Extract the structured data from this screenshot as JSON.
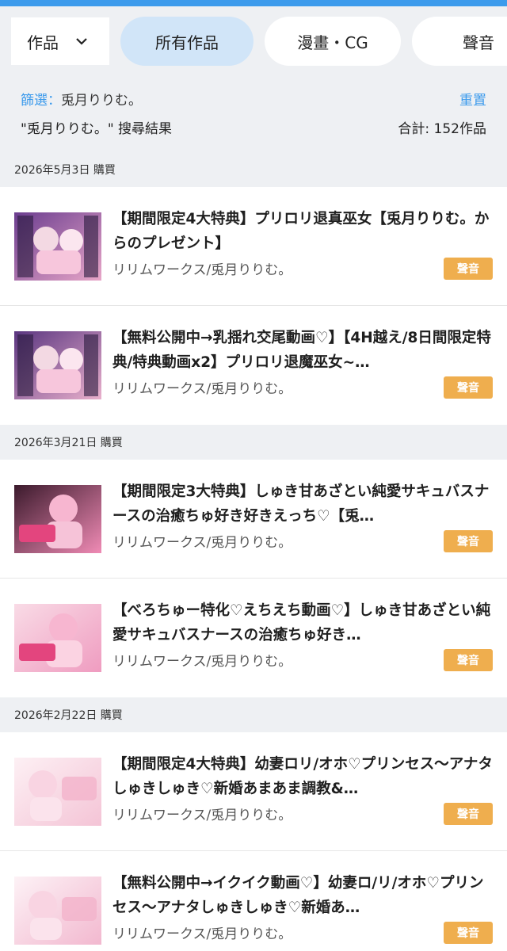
{
  "filters": {
    "type_select": "作品",
    "chips": [
      "所有作品",
      "漫畫・CG",
      "聲音"
    ]
  },
  "filter_info": {
    "label": "篩選：",
    "value": "兎月りりむ。",
    "reset": "重置",
    "query": "\"兎月りりむ。\" 搜尋結果",
    "total": "合計: 152作品"
  },
  "groups": [
    {
      "date": "2026年5月3日 購買",
      "items": [
        {
          "title": "【期間限定4大特典】プリロリ退真巫女【兎月りりむ。からのプレゼント】",
          "maker": "リリムワークス/兎月りりむ。",
          "badge": "聲音"
        },
        {
          "title": "【無料公開中→乳揺れ交尾動画♡】【4H越え/8日間限定特典/特典動画x2】プリロリ退魔巫女~…",
          "maker": "リリムワークス/兎月りりむ。",
          "badge": "聲音"
        }
      ]
    },
    {
      "date": "2026年3月21日 購買",
      "items": [
        {
          "title": "【期間限定3大特典】しゅき甘あざとい純愛サキュバスナースの治癒ちゅ好き好きえっち♡【兎…",
          "maker": "リリムワークス/兎月りりむ。",
          "badge": "聲音"
        },
        {
          "title": "【べろちゅー特化♡えちえち動画♡】しゅき甘あざとい純愛サキュバスナースの治癒ちゅ好き…",
          "maker": "リリムワークス/兎月りりむ。",
          "badge": "聲音"
        }
      ]
    },
    {
      "date": "2026年2月22日 購買",
      "items": [
        {
          "title": "【期間限定4大特典】幼妻ロリ/オホ♡プリンセス～アナタしゅきしゅき♡新婚あまあま調教&…",
          "maker": "リリムワークス/兎月りりむ。",
          "badge": "聲音"
        },
        {
          "title": "【無料公開中→イクイク動画♡】幼妻ロ/リ/オホ♡プリンセス～アナタしゅきしゅき♡新婚あ…",
          "maker": "リリムワークス/兎月りりむ。",
          "badge": "聲音"
        }
      ]
    }
  ],
  "colors": {
    "accent": "#3d9bec",
    "active_chip": "#d1e5f8",
    "badge": "#efae4e",
    "background": "#eef0f3"
  }
}
